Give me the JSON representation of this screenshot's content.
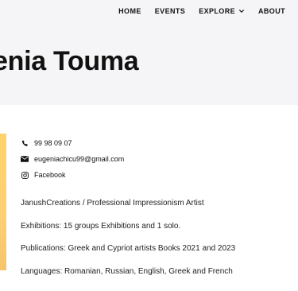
{
  "nav": {
    "items": [
      {
        "label": "HOME"
      },
      {
        "label": "EVENTS"
      },
      {
        "label": "EXPLORE"
      },
      {
        "label": "ABOUT"
      }
    ]
  },
  "hero": {
    "title": "enia Touma"
  },
  "contacts": {
    "phone": "99 98 09 07",
    "email": "eugeniachicu99@gmail.com",
    "facebook": "Facebook"
  },
  "bio": {
    "line1": "JanushCreations / Professional Impressionism Artist",
    "line2": "Exhibitions: 15 groups Exhibitions and 1 solo.",
    "line3": "Publications: Greek and Cypriot artists Books 2021 and 2023",
    "line4": "Languages: Romanian, Russian, English, Greek and French"
  },
  "colors": {
    "hero_bg": "#f5f5f7",
    "accent_strip": "#ffd36b",
    "text": "#111111"
  }
}
